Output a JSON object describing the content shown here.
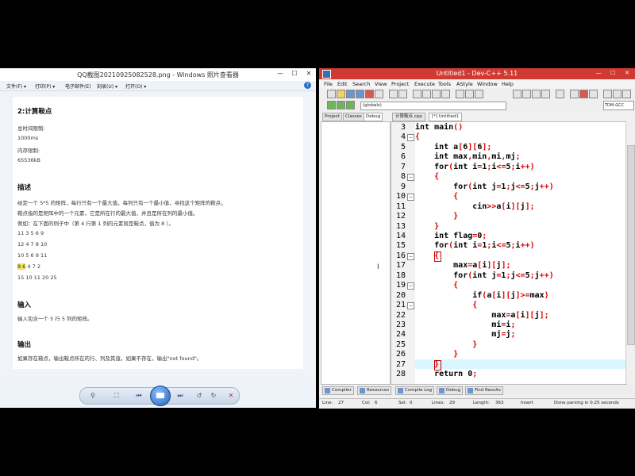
{
  "viewer": {
    "title": "QQ截图20210925082528.png - Windows 照片查看器",
    "menu": [
      "文件(F) ▾",
      "打印(P) ▾",
      "电子邮件(E)",
      "刻录(U) ▾",
      "打开(O) ▾"
    ],
    "help": "?",
    "doc": {
      "title": "2:计算鞍点",
      "limits": [
        "总时间限制:",
        "1000ms",
        "内存限制:",
        "65536kB"
      ],
      "desc_title": "描述",
      "desc_lines": [
        "给定一个 5*5 的矩阵，每行只有一个最大值，每列只有一个最小值，寻找这个矩阵的鞍点。",
        "鞍点指的是矩阵中的一个元素，它是所在行的最大值，并且是所在列的最小值。",
        "例如：在下面的例子中（第 4 行第 1 列的元素就是鞍点，值为 8 ）。"
      ],
      "matrix": [
        "11 3 5 6 9",
        "12 4 7 8 10",
        "10 5 6 9 11",
        "8 6 4 7 2",
        "15 10 11 20 25"
      ],
      "highlight": "8 6",
      "matrix_row4_rest": " 4 7 2",
      "input_title": "输入",
      "input_text": "输入包含一个 5 行 5 列的矩阵。",
      "output_title": "输出",
      "output_text": "如果存在鞍点，输出鞍点所在的行、列及其值，如果不存在，输出\"not found\"。"
    }
  },
  "ide": {
    "title": "Untitled1 - Dev-C++ 5.11",
    "menu": [
      "File",
      "Edit",
      "Search",
      "View",
      "Project",
      "Execute",
      "Tools",
      "AStyle",
      "Window",
      "Help"
    ],
    "globals": "(globals)",
    "compiler": "TDM-GCC",
    "left_tabs": [
      "Project",
      "Classes",
      "Debug"
    ],
    "file_tabs": [
      "计算鞍点.cpp",
      "[*] Untitled1"
    ],
    "lines": [
      {
        "n": "3",
        "code": "int main()"
      },
      {
        "n": "4",
        "code": "{"
      },
      {
        "n": "5",
        "code": "    int a[6][6];"
      },
      {
        "n": "6",
        "code": "    int max,min,mi,mj;"
      },
      {
        "n": "7",
        "code": "    for(int i=1;i<=5;i++)"
      },
      {
        "n": "8",
        "code": "    {"
      },
      {
        "n": "9",
        "code": "        for(int j=1;j<=5;j++)"
      },
      {
        "n": "10",
        "code": "        {"
      },
      {
        "n": "11",
        "code": "            cin>>a[i][j];"
      },
      {
        "n": "12",
        "code": "        }"
      },
      {
        "n": "13",
        "code": "    }"
      },
      {
        "n": "14",
        "code": "    int flag=0;"
      },
      {
        "n": "15",
        "code": "    for(int i=1;i<=5;i++)"
      },
      {
        "n": "16",
        "code": "    {"
      },
      {
        "n": "17",
        "code": "        max=a[i][j];"
      },
      {
        "n": "18",
        "code": "        for(int j=1;j<=5;j++)"
      },
      {
        "n": "19",
        "code": "        {"
      },
      {
        "n": "20",
        "code": "            if(a[i][j]>=max)"
      },
      {
        "n": "21",
        "code": "            {"
      },
      {
        "n": "22",
        "code": "                max=a[i][j];"
      },
      {
        "n": "23",
        "code": "                mi=i;"
      },
      {
        "n": "24",
        "code": "                mj=j;"
      },
      {
        "n": "25",
        "code": "            }"
      },
      {
        "n": "26",
        "code": "        }"
      },
      {
        "n": "27",
        "code": "    }"
      },
      {
        "n": "28",
        "code": "    return 0;"
      }
    ],
    "bottom_tabs": [
      "Compiler",
      "Resources",
      "Compile Log",
      "Debug",
      "Find Results"
    ],
    "status": {
      "line_label": "Line:",
      "line": "27",
      "col_label": "Col:",
      "col": "6",
      "sel_label": "Sel:",
      "sel": "0",
      "lines_label": "Lines:",
      "lines": "29",
      "length_label": "Length:",
      "length": "363",
      "mode": "Insert",
      "msg": "Done parsing in 0.25 seconds"
    }
  }
}
